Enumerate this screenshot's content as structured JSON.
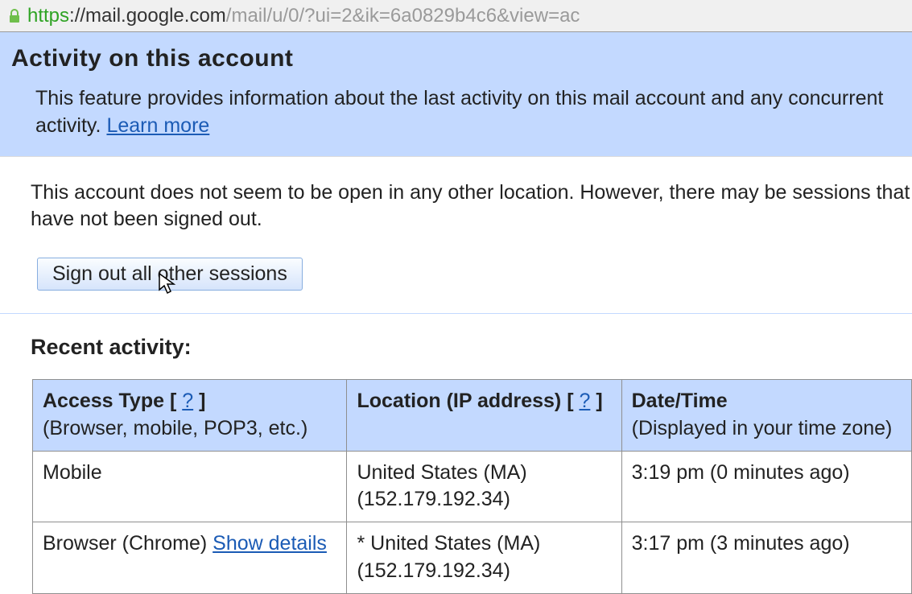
{
  "url": {
    "https": "https",
    "domain": "://mail.google.com",
    "path": "/mail/u/0/?ui=2&ik=6a0829b4c6&view=ac"
  },
  "banner": {
    "title": "Activity on this account",
    "desc_text": "This feature provides information about the last activity on this mail account and any concurrent activity. ",
    "learn_more": "Learn more"
  },
  "concurrent": {
    "text": "This account does not seem to be open in any other location. However, there may be sessions that have not been signed out."
  },
  "signout": {
    "label": "Sign out all other sessions"
  },
  "recent_label": "Recent activity:",
  "table": {
    "headers": {
      "access_type": "Access Type",
      "access_type_sub": "(Browser, mobile, POP3, etc.)",
      "location": "Location (IP address)",
      "datetime": "Date/Time",
      "datetime_sub": "(Displayed in your time zone)",
      "help": "?"
    },
    "rows": [
      {
        "access": "Mobile",
        "show_details": "",
        "location_line1": "United States (MA)",
        "location_line2": "(152.179.192.34)",
        "datetime": "3:19 pm (0 minutes ago)"
      },
      {
        "access": "Browser (Chrome) ",
        "show_details": "Show details",
        "location_line1": "* United States (MA)",
        "location_line2": "(152.179.192.34)",
        "datetime": "3:17 pm (3 minutes ago)"
      }
    ]
  }
}
